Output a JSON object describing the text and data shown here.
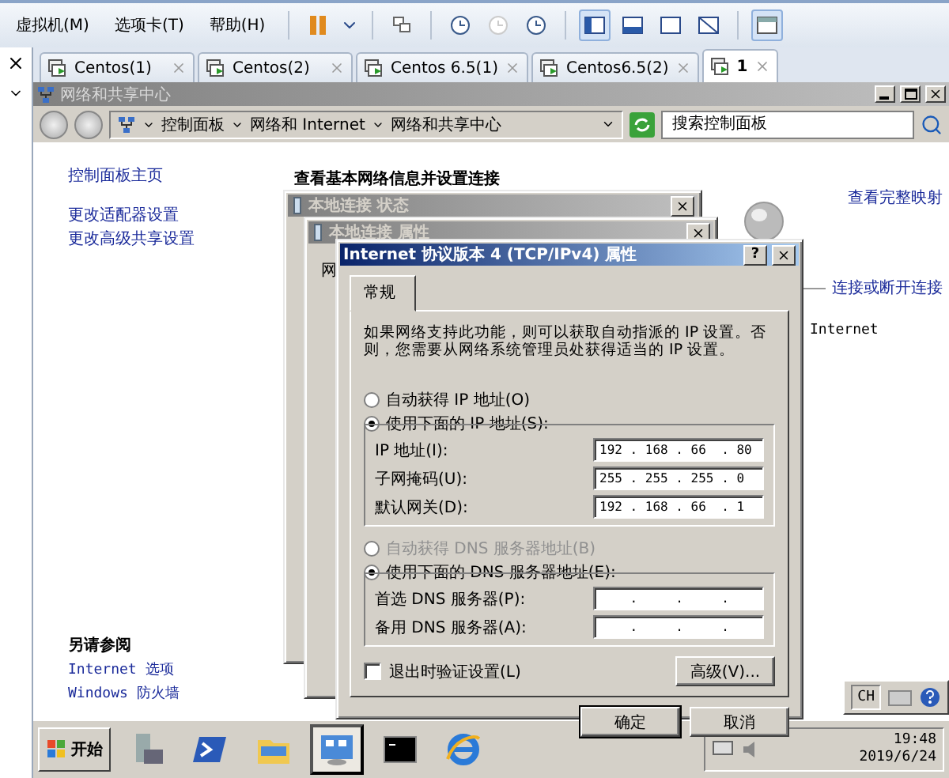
{
  "menu": [
    {
      "label": "虚拟机(M)"
    },
    {
      "label": "选项卡(T)"
    },
    {
      "label": "帮助(H)"
    }
  ],
  "view_buttons": [
    {
      "selected": true
    },
    {
      "selected": false
    },
    {
      "selected": false
    },
    {
      "selected": false
    }
  ],
  "console_button": {
    "selected": true
  },
  "tabs": [
    {
      "label": "Centos(1)",
      "selected": false
    },
    {
      "label": "Centos(2)",
      "selected": false
    },
    {
      "label": "Centos 6.5(1)",
      "selected": false
    },
    {
      "label": "Centos6.5(2)",
      "selected": false
    },
    {
      "label": "1",
      "selected": true
    }
  ],
  "explorer": {
    "title": "网络和共享中心",
    "breadcrumbs": [
      "控制面板",
      "网络和 Internet",
      "网络和共享中心"
    ],
    "search_placeholder": "搜索控制面板",
    "left_links": [
      "控制面板主页",
      "更改适配器设置",
      "更改高级共享设置"
    ],
    "see_also_title": "另请参阅",
    "see_also_links": [
      "Internet 选项",
      "Windows 防火墙"
    ],
    "heading": "查看基本网络信息并设置连接",
    "map_link": "查看完整映射",
    "connect_link": "连接或断开连接",
    "network_label": "Internet"
  },
  "status_dialog": {
    "title": "本地连接 状态"
  },
  "properties_dialog": {
    "title": "本地连接 属性",
    "tab": "网"
  },
  "ipv4_dialog": {
    "title": "Internet 协议版本 4 (TCP/IPv4) 属性",
    "help_button": "?",
    "tab": "常规",
    "intro": "如果网络支持此功能，则可以获取自动指派的 IP 设置。否则，您需要从网络系统管理员处获得适当的 IP 设置。",
    "ip_radios": [
      {
        "label": "自动获得 IP 地址(O)",
        "selected": false,
        "disabled": false
      },
      {
        "label": "使用下面的 IP 地址(S):",
        "selected": true,
        "disabled": false
      }
    ],
    "ip_fields": [
      {
        "label": "IP 地址(I):",
        "value": "192 . 168 . 66  . 80"
      },
      {
        "label": "子网掩码(U):",
        "value": "255 . 255 . 255 . 0"
      },
      {
        "label": "默认网关(D):",
        "value": "192 . 168 . 66  . 1"
      }
    ],
    "dns_radios": [
      {
        "label": "自动获得 DNS 服务器地址(B)",
        "selected": false,
        "disabled": true
      },
      {
        "label": "使用下面的 DNS 服务器地址(E):",
        "selected": true,
        "disabled": false
      }
    ],
    "dns_fields": [
      {
        "label": "首选 DNS 服务器(P):",
        "value": "    .     .     ."
      },
      {
        "label": "备用 DNS 服务器(A):",
        "value": "    .     .     ."
      }
    ],
    "validate": {
      "label": "退出时验证设置(L)",
      "checked": false
    },
    "advanced_button": "高级(V)...",
    "ok_button": "确定",
    "cancel_button": "取消"
  },
  "taskbar": {
    "start": "开始",
    "language": "CH",
    "time": "19:48",
    "date": "2019/6/24"
  }
}
